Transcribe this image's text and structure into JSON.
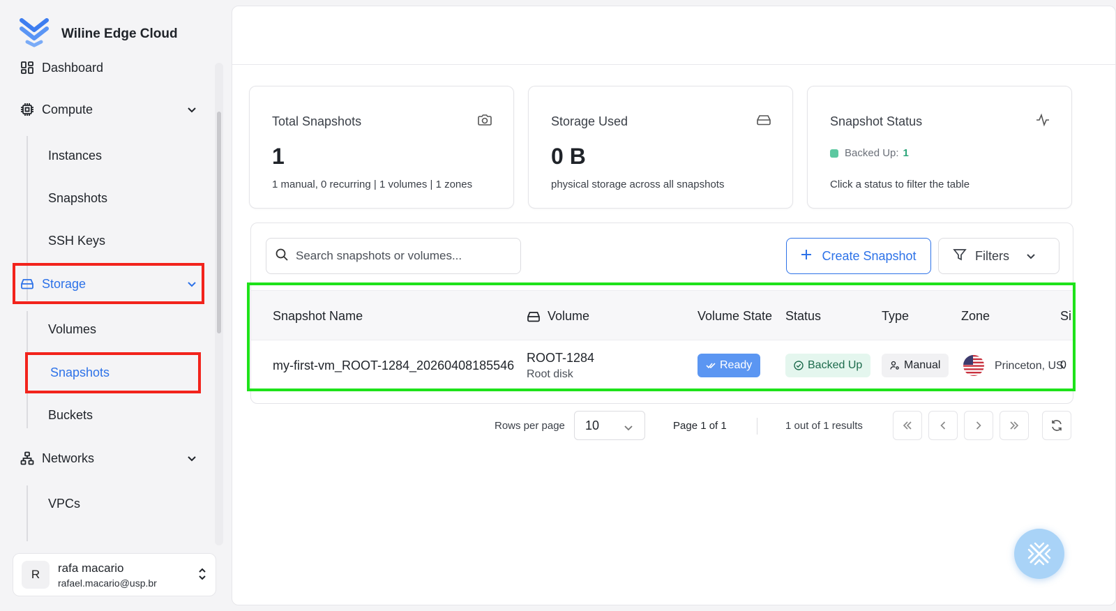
{
  "brand": {
    "name": "Wiline Edge Cloud",
    "accent": "#2d72e8"
  },
  "sidebar": {
    "items": [
      {
        "label": "Dashboard",
        "icon": "dashboard-icon"
      },
      {
        "label": "Compute",
        "icon": "cpu-icon",
        "children": [
          "Instances",
          "Snapshots",
          "SSH Keys"
        ]
      },
      {
        "label": "Storage",
        "icon": "storage-icon",
        "active": true,
        "children": [
          "Volumes",
          "Snapshots",
          "Buckets"
        ]
      },
      {
        "label": "Networks",
        "icon": "network-icon",
        "children": [
          "VPCs"
        ]
      }
    ]
  },
  "user": {
    "initial": "R",
    "name": "rafa macario",
    "email": "rafael.macario@usp.br"
  },
  "cards": {
    "total": {
      "title": "Total Snapshots",
      "value": "1",
      "sub": "1 manual, 0 recurring | 1 volumes | 1 zones",
      "icon": "camera-icon"
    },
    "storage": {
      "title": "Storage Used",
      "value": "0 B",
      "sub": "physical storage across all snapshots",
      "icon": "hard-drive-icon"
    },
    "status": {
      "title": "Snapshot Status",
      "status_label": "Backed Up:",
      "status_count": "1",
      "sub": "Click a status to filter the table",
      "icon": "activity-icon"
    }
  },
  "toolbar": {
    "search_placeholder": "Search snapshots or volumes...",
    "create_label": "Create Snapshot",
    "filters_label": "Filters"
  },
  "table": {
    "columns": [
      "Snapshot Name",
      "Volume",
      "Volume State",
      "Status",
      "Type",
      "Zone",
      "Si"
    ],
    "rows": [
      {
        "name": "my-first-vm_ROOT-1284_20260408185546",
        "volume": "ROOT-1284",
        "volume_sub": "Root disk",
        "volume_state": "Ready",
        "status": "Backed Up",
        "type": "Manual",
        "zone": "Princeton, USA",
        "size": "0"
      }
    ]
  },
  "pagination": {
    "rows_per_page_label": "Rows per page",
    "rows_per_page": "10",
    "page_label": "Page 1 of 1",
    "results_label": "1 out of 1 results"
  },
  "colors": {
    "highlight_red": "#f2231c",
    "highlight_green": "#1ee21a",
    "ready": "#5b96f2",
    "backed_up_bg": "#e4f6ee"
  }
}
